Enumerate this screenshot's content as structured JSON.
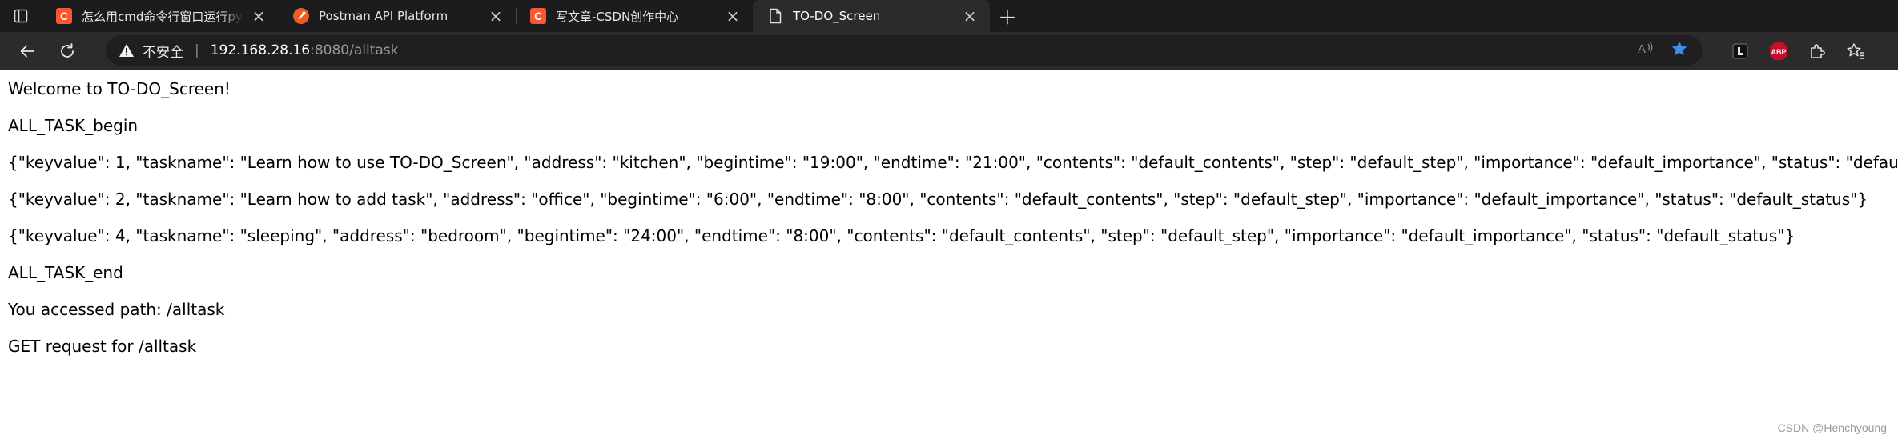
{
  "browser": {
    "tabs": [
      {
        "title": "怎么用cmd命令行窗口运行python",
        "favicon": "csdn-icon",
        "active": false
      },
      {
        "title": "Postman API Platform",
        "favicon": "postman-icon",
        "active": false
      },
      {
        "title": "写文章-CSDN创作中心",
        "favicon": "csdn-icon",
        "active": false
      },
      {
        "title": "TO-DO_Screen",
        "favicon": "page-icon",
        "active": true
      }
    ],
    "address": {
      "security_label": "不安全",
      "divider": "|",
      "host": "192.168.28.16",
      "rest": ":8080/alltask"
    },
    "colors": {
      "csdn": "#fc5531",
      "postman": "#ef5b25",
      "abp": "#c70d2c",
      "star": "#3b8eea"
    }
  },
  "page": {
    "lines": [
      "Welcome to TO-DO_Screen!",
      "ALL_TASK_begin",
      "{\"keyvalue\": 1, \"taskname\": \"Learn how to use TO-DO_Screen\", \"address\": \"kitchen\", \"begintime\": \"19:00\", \"endtime\": \"21:00\", \"contents\": \"default_contents\", \"step\": \"default_step\", \"importance\": \"default_importance\", \"status\": \"default_status\"}",
      "{\"keyvalue\": 2, \"taskname\": \"Learn how to add task\", \"address\": \"office\", \"begintime\": \"6:00\", \"endtime\": \"8:00\", \"contents\": \"default_contents\", \"step\": \"default_step\", \"importance\": \"default_importance\", \"status\": \"default_status\"}",
      "{\"keyvalue\": 4, \"taskname\": \"sleeping\", \"address\": \"bedroom\", \"begintime\": \"24:00\", \"endtime\": \"8:00\", \"contents\": \"default_contents\", \"step\": \"default_step\", \"importance\": \"default_importance\", \"status\": \"default_status\"}",
      "ALL_TASK_end",
      "You accessed path: /alltask",
      "GET request for /alltask"
    ],
    "watermark": "CSDN @Henchyoung"
  }
}
